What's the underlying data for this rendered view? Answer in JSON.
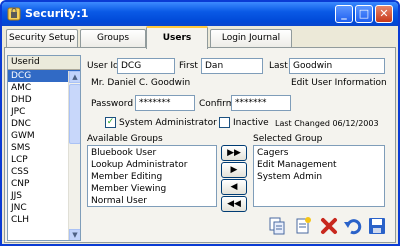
{
  "window": {
    "title": "Security:1"
  },
  "titlebar_buttons": {
    "minimize": "_",
    "maximize": "□",
    "close": "✕"
  },
  "tabs": [
    {
      "label": "Security Setup"
    },
    {
      "label": "Groups"
    },
    {
      "label": "Users"
    },
    {
      "label": "Login Journal"
    }
  ],
  "userid_list": {
    "header": "Userid",
    "items": [
      "DCG",
      "AMC",
      "DHD",
      "JPC",
      "DNC",
      "GWM",
      "SMS",
      "LCP",
      "CSS",
      "CNP",
      "JJS",
      "JNC",
      "CLH"
    ],
    "selected": "DCG"
  },
  "form": {
    "userid_label": "User Id",
    "userid_value": "DCG",
    "first_label": "First",
    "first_value": "Dan",
    "last_label": "Last",
    "last_value": "Goodwin",
    "full_name": "Mr. Daniel C. Goodwin",
    "edit_info_link": "Edit User Information",
    "password_label": "Password",
    "password_value": "*******",
    "confirm_label": "Confirm",
    "confirm_value": "*******",
    "sysadmin_label": "System Administrator",
    "sysadmin_checked": true,
    "inactive_label": "Inactive",
    "inactive_checked": false,
    "last_changed": "Last Changed 06/12/2003"
  },
  "available_groups": {
    "label": "Available Groups",
    "items": [
      "Bluebook User",
      "Lookup Administrator",
      "Member Editing",
      "Member Viewing",
      "Normal User"
    ]
  },
  "selected_groups": {
    "label": "Selected Group",
    "items": [
      "Cagers",
      "Edit Management",
      "System Admin"
    ]
  },
  "move_buttons": {
    "add_all": "▶▶",
    "add": "▶",
    "remove": "◀",
    "remove_all": "◀◀"
  },
  "toolbar": {
    "icons": [
      "copy-icon",
      "new-icon",
      "delete-icon",
      "undo-icon",
      "save-icon"
    ]
  },
  "colors": {
    "title_bar": "#0a5ae6",
    "selection": "#316ac5",
    "tab_accent": "#ffc83c"
  }
}
